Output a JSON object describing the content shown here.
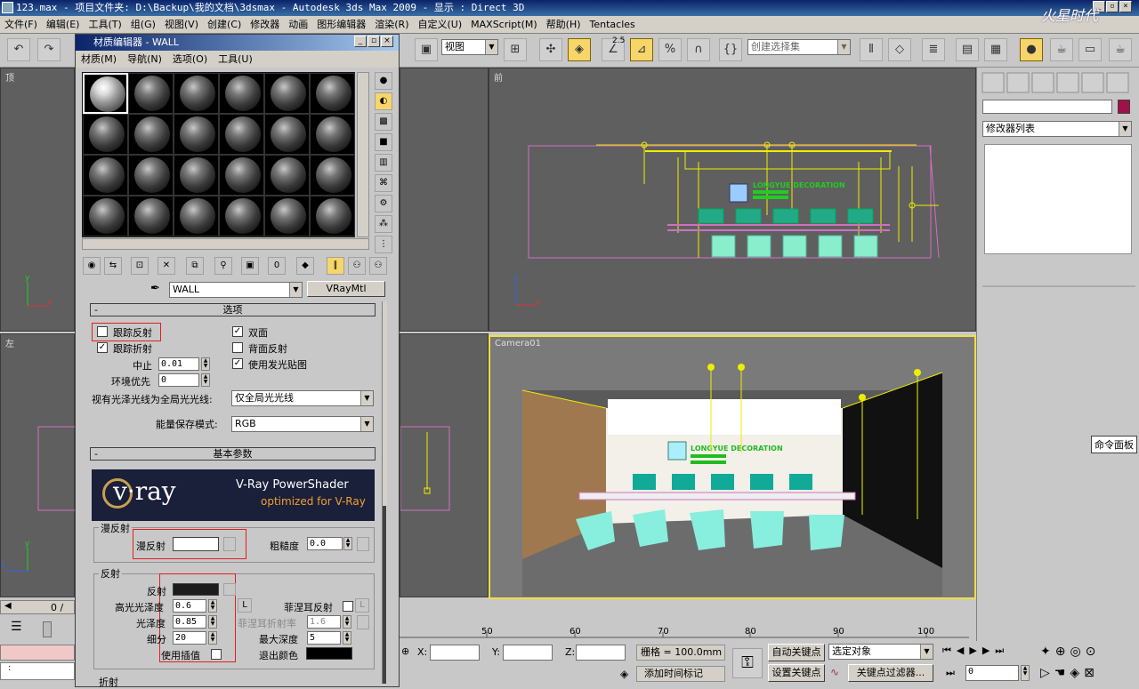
{
  "window": {
    "title": "123.max   - 项目文件夹: D:\\Backup\\我的文档\\3dsmax   - Autodesk 3ds Max  2009   - 显示 : Direct 3D"
  },
  "watermark": "火星时代",
  "menu": [
    "文件(F)",
    "编辑(E)",
    "工具(T)",
    "组(G)",
    "视图(V)",
    "创建(C)",
    "修改器",
    "动画",
    "图形编辑器",
    "渲染(R)",
    "自定义(U)",
    "MAXScript(M)",
    "帮助(H)",
    "Tentacles"
  ],
  "toolbar": {
    "view_combo": "视图",
    "selection_set_placeholder": "创建选择集",
    "snap_value": "2.5"
  },
  "viewports": {
    "top": "顶",
    "front": "前",
    "left": "左",
    "camera": "Camera01",
    "camera_scene_text": "LONGYUE DECORATION"
  },
  "cmdpanel": {
    "modifier_list": "修改器列表",
    "tooltip": "命令面板"
  },
  "material_editor": {
    "title": "材质编辑器 - WALL",
    "menu": [
      "材质(M)",
      "导航(N)",
      "选项(O)",
      "工具(U)"
    ],
    "material_name": "WALL",
    "material_type": "VRayMtl",
    "options": {
      "header": "选项",
      "trace_reflections": "跟踪反射",
      "trace_refractions": "跟踪折射",
      "cutoff_label": "中止",
      "cutoff_value": "0.01",
      "env_priority_label": "环境优先",
      "env_priority_value": "0",
      "double_sided": "双面",
      "reflect_backside": "背面反射",
      "use_irradiance_map": "使用发光贴图",
      "treat_glossy_label": "视有光泽光线为全局光光线:",
      "treat_glossy_value": "仅全局光光线",
      "energy_mode_label": "能量保存模式:",
      "energy_mode_value": "RGB"
    },
    "basic": {
      "header": "基本参数",
      "banner_logo": "v·ray",
      "banner_title": "V-Ray PowerShader",
      "banner_sub": "optimized for V-Ray",
      "diffuse_group": "漫反射",
      "diffuse_label": "漫反射",
      "roughness_label": "粗糙度",
      "roughness_value": "0.0",
      "reflection_group": "反射",
      "reflect_label": "反射",
      "hilight_gloss_label": "高光光泽度",
      "hilight_gloss_value": "0.6",
      "fresnel_label": "菲涅耳反射",
      "refl_gloss_label": "光泽度",
      "refl_gloss_value": "0.85",
      "fresnel_ior_label": "菲涅耳折射率",
      "fresnel_ior_value": "1.6",
      "subdivs_label": "细分",
      "subdivs_value": "20",
      "max_depth_label": "最大深度",
      "max_depth_value": "5",
      "use_interp_label": "使用插值",
      "exit_color_label": "退出颜色",
      "lock_label": "L",
      "refraction_group": "折射"
    }
  },
  "timeline": {
    "frame": "0 /",
    "ticks": [
      "50",
      "60",
      "70",
      "80",
      "90",
      "100"
    ]
  },
  "status": {
    "x_label": "X:",
    "y_label": "Y:",
    "z_label": "Z:",
    "grid": "栅格 = 100.0mm",
    "add_time_tag": "添加时间标记",
    "auto_key": "自动关键点",
    "set_key": "设置关键点",
    "selected": "选定对象",
    "key_filter": "关键点过滤器...",
    "frame_value": "0"
  },
  "colors": {
    "titlebar": "#0a246a",
    "highlight_yellow": "#f6d66a",
    "red_box": "#e02020",
    "vray_banner": "#1a1f3a"
  }
}
